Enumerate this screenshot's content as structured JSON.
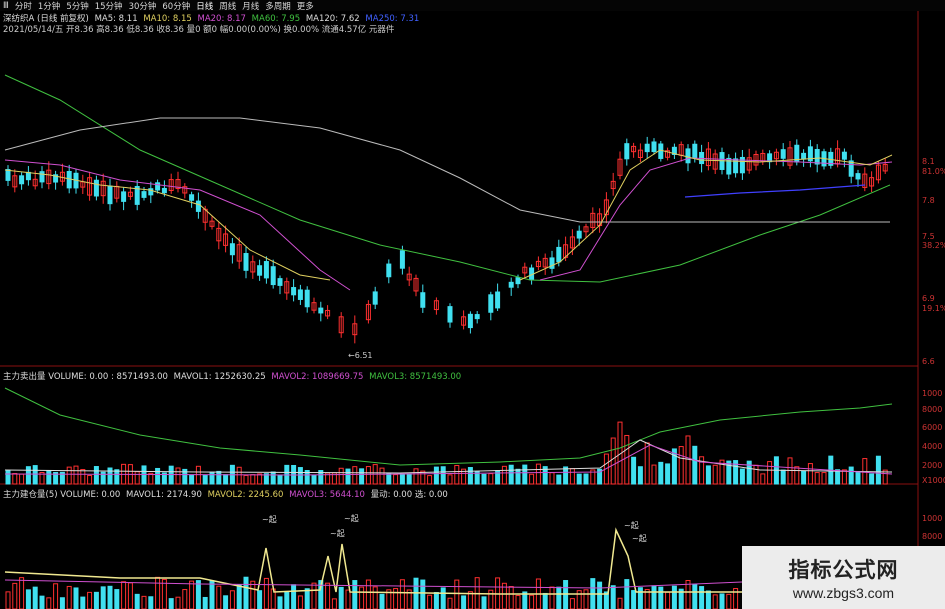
{
  "toolbar": {
    "items": [
      {
        "label": "Ⅲ"
      },
      {
        "label": "分时"
      },
      {
        "label": "1分钟"
      },
      {
        "label": "5分钟"
      },
      {
        "label": "15分钟"
      },
      {
        "label": "30分钟"
      },
      {
        "label": "60分钟"
      },
      {
        "label": "日线"
      },
      {
        "label": "周线"
      },
      {
        "label": "月线"
      },
      {
        "label": "多周期"
      },
      {
        "label": "更多"
      }
    ]
  },
  "main_panel": {
    "stock": "深纺织A (日线 前复权)",
    "ma5": "MA5: 8.11",
    "ma10": "MA10: 8.15",
    "ma20": "MA20: 8.17",
    "ma60": "MA60: 7.95",
    "ma120": "MA120: 7.62",
    "ma250": "MA250: 7.31",
    "quote": "2021/05/14/五 开8.36 高8.36 低8.36 收8.36 量0 额0 幅0.00(0.00%) 换0.00% 流通4.57亿 元器件",
    "low_label": "6.51",
    "colors": {
      "ma5": "#e0e0e0",
      "ma10": "#e0d060",
      "ma20": "#d050d0",
      "ma60": "#40c040",
      "ma120": "#e0e0e0",
      "ma250": "#4040ff",
      "up": "#ff3030",
      "down": "#40e0f0"
    }
  },
  "volume_panel": {
    "title": "主力卖出量 VOLUME: 0.00 : 8571493.00",
    "mavol1": "MAVOL1: 1252630.25",
    "mavol2": "MAVOL2: 1089669.75",
    "mavol3": "MAVOL3: 8571493.00"
  },
  "position_panel": {
    "title": "主力建仓量(5) VOLUME: 0.00",
    "mavol1": "MAVOL1: 2174.90",
    "mavol2": "MAVOL2: 2245.60",
    "mavol3": "MAVOL3: 5644.10",
    "extra": "量动: 0.00 选: 0.00",
    "annotations": [
      "起",
      "起",
      "起",
      "起",
      "起"
    ]
  },
  "right_axis": {
    "main": [
      "8.1",
      "81.0%",
      "7.8",
      "7.5",
      "38.2%",
      "6.9",
      "19.1%",
      "6.6"
    ],
    "volume": [
      "1000",
      "8000",
      "6000",
      "4000",
      "2000",
      "X1000"
    ],
    "position": [
      "1000",
      "8000"
    ]
  },
  "watermark": {
    "line1": "指标公式网",
    "line2": "www.zbgs3.com"
  }
}
